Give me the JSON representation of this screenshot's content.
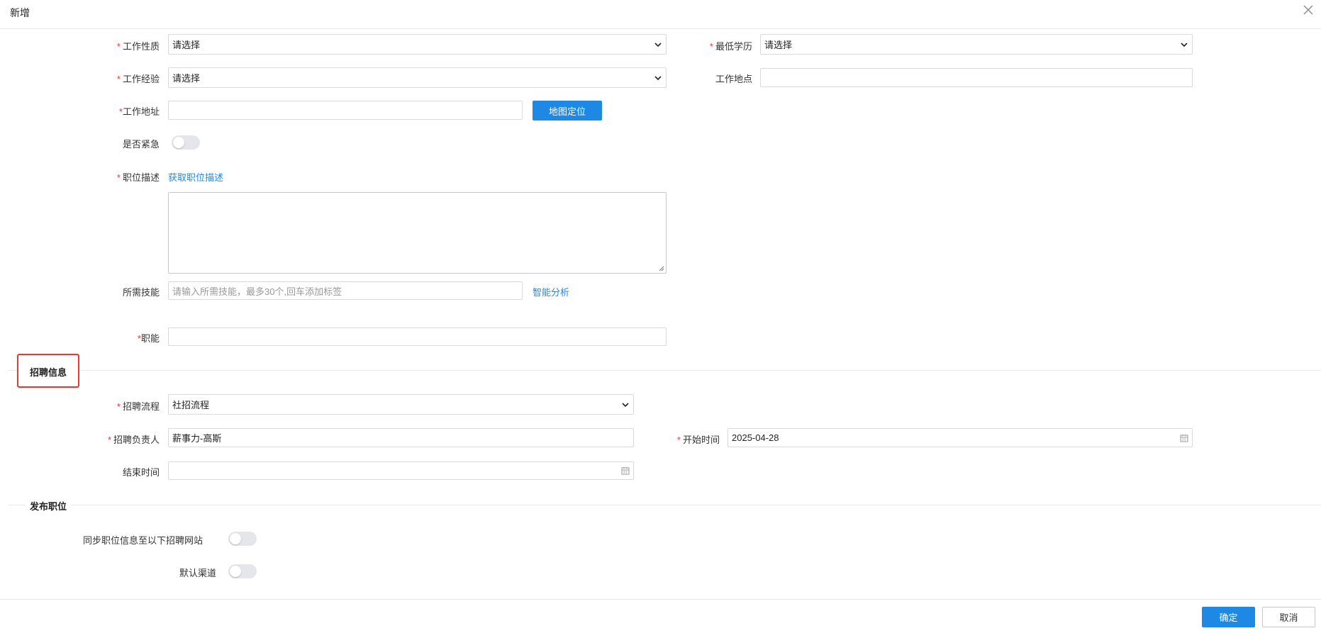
{
  "dialog": {
    "title": "新增",
    "close_icon": "close-icon"
  },
  "fields": {
    "job_nature": {
      "label": "工作性质",
      "required": "*",
      "value": "请选择"
    },
    "min_education": {
      "label": "最低学历",
      "required": "*",
      "value": "请选择"
    },
    "experience": {
      "label": "工作经验",
      "required": "*",
      "value": "请选择"
    },
    "location": {
      "label": "工作地点",
      "value": ""
    },
    "address": {
      "label": "工作地址",
      "required": "*",
      "value": "",
      "map_button": "地图定位"
    },
    "urgent": {
      "label": "是否紧急",
      "on": false
    },
    "description": {
      "label": "职位描述",
      "required": "*",
      "link": "获取职位描述",
      "value": ""
    },
    "skills": {
      "label": "所需技能",
      "placeholder": "请输入所需技能，最多30个,回车添加标签",
      "link": "智能分析"
    },
    "function": {
      "label": "职能",
      "required": "*",
      "value": ""
    }
  },
  "recruit_section": {
    "title": "招聘信息",
    "process": {
      "label": "招聘流程",
      "required": "*",
      "value": "社招流程"
    },
    "owner": {
      "label": "招聘负责人",
      "required": "*",
      "value": "薪事力-高斯"
    },
    "start_time": {
      "label": "开始时间",
      "required": "*",
      "value": "2025-04-28"
    },
    "end_time": {
      "label": "结束时间",
      "value": ""
    }
  },
  "publish_section": {
    "title": "发布职位",
    "sync": {
      "label": "同步职位信息至以下招聘网站",
      "on": false
    },
    "default_channel": {
      "label": "默认渠道",
      "on": false
    }
  },
  "footer": {
    "confirm": "确定",
    "cancel": "取消"
  },
  "colors": {
    "primary": "#1e88e5",
    "required": "#e53935",
    "highlight": "#e53935"
  }
}
